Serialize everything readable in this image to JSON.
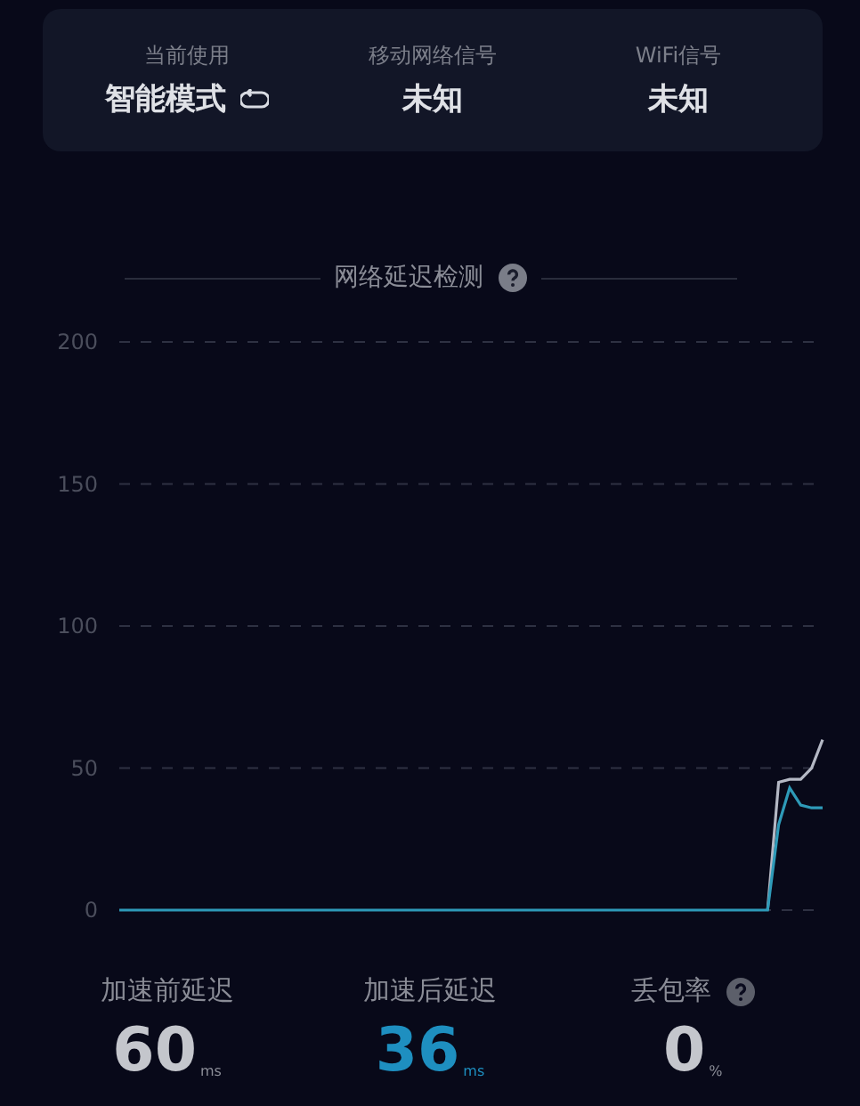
{
  "status": [
    {
      "label": "当前使用",
      "value": "智能模式",
      "refresh": true
    },
    {
      "label": "移动网络信号",
      "value": "未知",
      "refresh": false
    },
    {
      "label": "WiFi信号",
      "value": "未知",
      "refresh": false
    }
  ],
  "latency_section": {
    "title": "网络延迟检测",
    "help": true
  },
  "chart_data": {
    "type": "line",
    "grid": true,
    "ylim": [
      0,
      200
    ],
    "yticks": [
      0,
      50,
      100,
      150,
      200
    ],
    "series": [
      {
        "color": "#b4b8c4",
        "values": [
          null,
          null,
          null,
          null,
          null,
          null,
          null,
          null,
          null,
          null,
          null,
          null,
          null,
          null,
          null,
          null,
          null,
          null,
          null,
          null,
          null,
          null,
          null,
          null,
          null,
          null,
          null,
          null,
          null,
          null,
          null,
          null,
          null,
          null,
          null,
          null,
          null,
          null,
          null,
          null,
          null,
          null,
          null,
          null,
          null,
          null,
          null,
          null,
          null,
          null,
          null,
          null,
          null,
          null,
          null,
          null,
          null,
          null,
          null,
          0,
          45,
          46,
          46,
          50,
          60
        ]
      },
      {
        "color": "#2e9ab8",
        "values": [
          0,
          0,
          0,
          0,
          0,
          0,
          0,
          0,
          0,
          0,
          0,
          0,
          0,
          0,
          0,
          0,
          0,
          0,
          0,
          0,
          0,
          0,
          0,
          0,
          0,
          0,
          0,
          0,
          0,
          0,
          0,
          0,
          0,
          0,
          0,
          0,
          0,
          0,
          0,
          0,
          0,
          0,
          0,
          0,
          0,
          0,
          0,
          0,
          0,
          0,
          0,
          0,
          0,
          0,
          0,
          0,
          0,
          0,
          0,
          0,
          30,
          43,
          37,
          36,
          36
        ]
      }
    ]
  },
  "stats": [
    {
      "label": "加速前延迟",
      "value": "60",
      "unit": "ms",
      "highlight": false,
      "help": false
    },
    {
      "label": "加速后延迟",
      "value": "36",
      "unit": "ms",
      "highlight": true,
      "help": false
    },
    {
      "label": "丢包率",
      "value": "0",
      "unit": "%",
      "highlight": false,
      "help": true
    }
  ]
}
